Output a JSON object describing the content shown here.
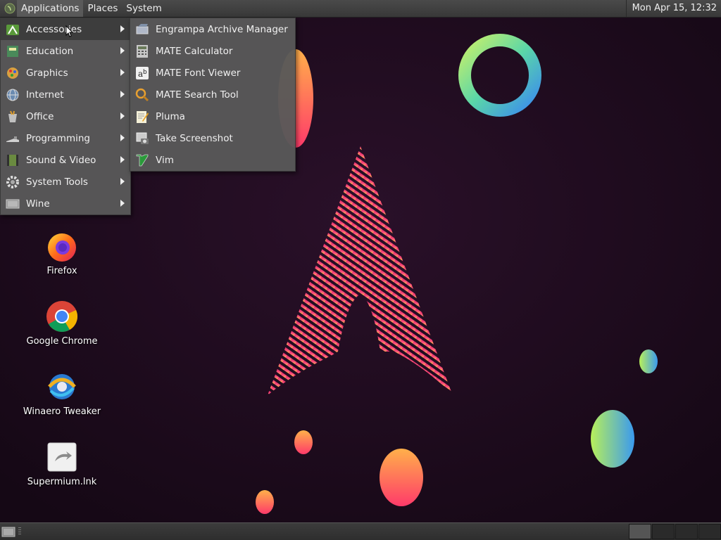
{
  "panel": {
    "menus": [
      "Applications",
      "Places",
      "System"
    ],
    "clock": "Mon Apr 15, 12:32"
  },
  "main_menu": {
    "items": [
      {
        "label": "Accessories",
        "icon": "accessories-icon",
        "selected": true
      },
      {
        "label": "Education",
        "icon": "education-icon"
      },
      {
        "label": "Graphics",
        "icon": "graphics-icon"
      },
      {
        "label": "Internet",
        "icon": "internet-icon"
      },
      {
        "label": "Office",
        "icon": "office-icon"
      },
      {
        "label": "Programming",
        "icon": "programming-icon"
      },
      {
        "label": "Sound & Video",
        "icon": "sound-video-icon"
      },
      {
        "label": "System Tools",
        "icon": "system-tools-icon"
      },
      {
        "label": "Wine",
        "icon": "wine-icon"
      }
    ]
  },
  "sub_menu": {
    "items": [
      {
        "label": "Engrampa Archive Manager",
        "icon": "archive-manager-icon"
      },
      {
        "label": "MATE Calculator",
        "icon": "calculator-icon"
      },
      {
        "label": "MATE Font Viewer",
        "icon": "font-viewer-icon"
      },
      {
        "label": "MATE Search Tool",
        "icon": "search-tool-icon"
      },
      {
        "label": "Pluma",
        "icon": "text-editor-icon"
      },
      {
        "label": "Take Screenshot",
        "icon": "screenshot-icon"
      },
      {
        "label": "Vim",
        "icon": "vim-icon"
      }
    ]
  },
  "desktop_icons": [
    {
      "label": "Firefox",
      "icon": "firefox-icon"
    },
    {
      "label": "Google Chrome",
      "icon": "chrome-icon"
    },
    {
      "label": "Winaero Tweaker",
      "icon": "winaero-tweaker-icon"
    },
    {
      "label": "Supermium.lnk",
      "icon": "shortcut-icon"
    }
  ],
  "colors": {
    "panel": "#3f3f3f",
    "menu": "#585858",
    "selected": "#3d3d3d",
    "wallpaper": "#1c0b1c"
  }
}
